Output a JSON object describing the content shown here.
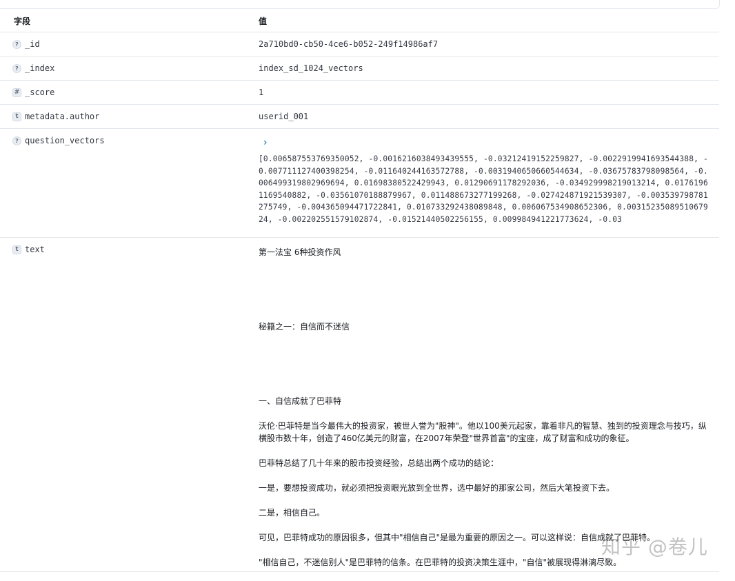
{
  "table": {
    "headers": {
      "field": "字段",
      "value": "值"
    },
    "rows": [
      {
        "icon": "?",
        "field": "_id",
        "value": "2a710bd0-cb50-4ce6-b052-249f14986af7"
      },
      {
        "icon": "?",
        "field": "_index",
        "value": "index_sd_1024_vectors"
      },
      {
        "icon": "#",
        "field": "_score",
        "value": "1"
      },
      {
        "icon": "t",
        "field": "metadata.author",
        "value": "userid_001"
      }
    ],
    "vector": {
      "icon": "?",
      "field": "question_vectors",
      "expand_glyph": "›",
      "value": "[0.006587553769350052, -0.0016216038493439555, -0.03212419152259827, -0.0022919941693544388, -0.007711127400398254, -0.011640244163572788, -0.0031940650660544634, -0.03675783798098564, -0.006499319802969694, 0.01698380522429943, 0.01290691178292036, -0.034929998219013214, 0.01761961169540882, -0.03561070188879967, 0.011488673277199268, -0.027424871921539307, -0.003539798781275749, -0.004365094471722841, 0.010733292438089848, 0.006067534908652306, 0.0031523508951067924, -0.002202551579102874, -0.01521440502256155, 0.009984941221773624, -0.03"
    },
    "text_row": {
      "icon": "t",
      "field": "text",
      "title": "第一法宝  6种投资作风",
      "secret": "秘籍之一：自信而不迷信",
      "heading": "一、自信成就了巴菲特",
      "p1": "沃伦·巴菲特是当今最伟大的投资家，被世人誉为\"股神\"。他以100美元起家，靠着非凡的智慧、独到的投资理念与技巧，纵横股市数十年，创造了460亿美元的财富，在2007年荣登\"世界首富\"的宝座，成了财富和成功的象征。",
      "p2": "巴菲特总结了几十年来的股市投资经验，总结出两个成功的结论：",
      "p3": "一是，要想投资成功，就必须把投资眼光放到全世界，选中最好的那家公司，然后大笔投资下去。",
      "p4": "二是，相信自己。",
      "p5": "可见，巴菲特成功的原因很多，但其中\"相信自己\"是最为重要的原因之一。可以这样说：自信成就了巴菲特。",
      "p6": "\"相信自己，不迷信别人\"是巴菲特的信条。在巴菲特的投资决策生涯中，\"自信\"被展现得淋漓尽致。"
    }
  },
  "watermark": "知乎 @卷儿"
}
